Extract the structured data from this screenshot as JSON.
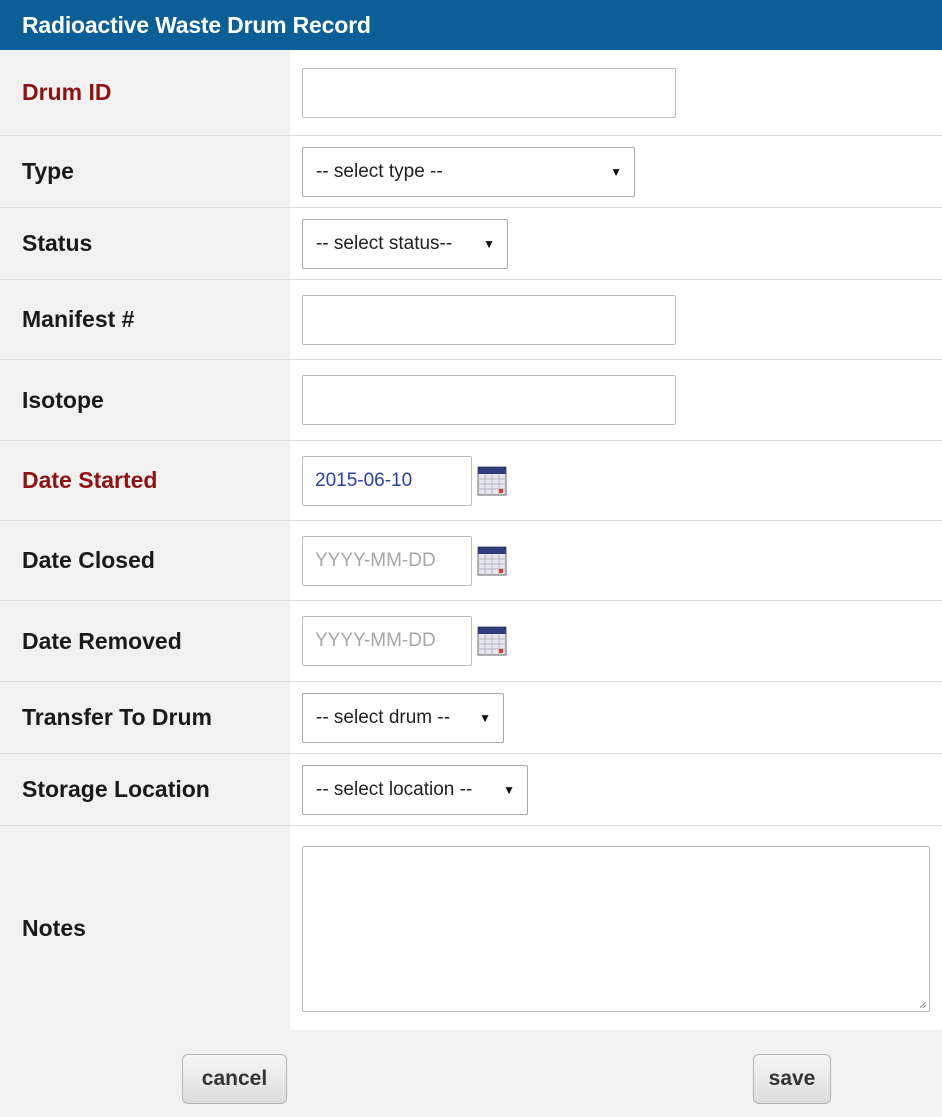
{
  "header": {
    "title": "Radioactive Waste Drum Record"
  },
  "fields": {
    "drum_id": {
      "label": "Drum ID",
      "value": ""
    },
    "type": {
      "label": "Type",
      "selected": "-- select type --"
    },
    "status": {
      "label": "Status",
      "selected": "-- select status--"
    },
    "manifest": {
      "label": "Manifest #",
      "value": ""
    },
    "isotope": {
      "label": "Isotope",
      "value": ""
    },
    "date_started": {
      "label": "Date Started",
      "value": "2015-06-10"
    },
    "date_closed": {
      "label": "Date Closed",
      "placeholder": "YYYY-MM-DD"
    },
    "date_removed": {
      "label": "Date Removed",
      "placeholder": "YYYY-MM-DD"
    },
    "transfer": {
      "label": "Transfer To Drum",
      "selected": "-- select drum --"
    },
    "storage": {
      "label": "Storage Location",
      "selected": "-- select location --"
    },
    "notes": {
      "label": "Notes",
      "value": ""
    }
  },
  "buttons": {
    "cancel": "cancel",
    "save": "save"
  },
  "icons": {
    "caret": "▼",
    "calendar": "calendar-icon"
  },
  "colors": {
    "header_bg": "#0b5e96",
    "required_label": "#8b1313",
    "date_value": "#2a3fa8",
    "placeholder": "#a7a7a7"
  }
}
